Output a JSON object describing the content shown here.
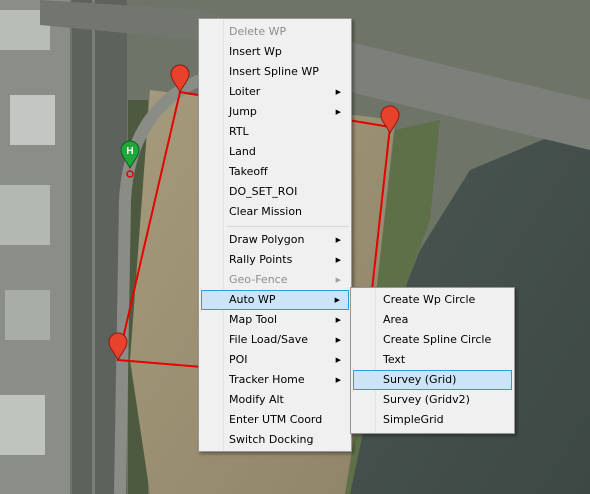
{
  "colors": {
    "mission_line": "#e60000",
    "waypoint_marker": "#e8412c",
    "home_marker": "#1ea83a",
    "menu_bg": "#f0f0f0",
    "menu_highlight": "#cce4f7",
    "menu_highlight_border": "#26a0da"
  },
  "map": {
    "home_marker_label": "H"
  },
  "context_menu": {
    "items": [
      {
        "label": "Delete WP",
        "disabled": true,
        "submenu": false
      },
      {
        "label": "Insert Wp",
        "disabled": false,
        "submenu": false
      },
      {
        "label": "Insert Spline WP",
        "disabled": false,
        "submenu": false
      },
      {
        "label": "Loiter",
        "disabled": false,
        "submenu": true
      },
      {
        "label": "Jump",
        "disabled": false,
        "submenu": true
      },
      {
        "label": "RTL",
        "disabled": false,
        "submenu": false
      },
      {
        "label": "Land",
        "disabled": false,
        "submenu": false
      },
      {
        "label": "Takeoff",
        "disabled": false,
        "submenu": false
      },
      {
        "label": "DO_SET_ROI",
        "disabled": false,
        "submenu": false
      },
      {
        "label": "Clear Mission",
        "disabled": false,
        "submenu": false
      },
      {
        "label": "Draw Polygon",
        "disabled": false,
        "submenu": true
      },
      {
        "label": "Rally Points",
        "disabled": false,
        "submenu": true
      },
      {
        "label": "Geo-Fence",
        "disabled": true,
        "submenu": true
      },
      {
        "label": "Auto WP",
        "disabled": false,
        "submenu": true,
        "highlighted": true
      },
      {
        "label": "Map Tool",
        "disabled": false,
        "submenu": true
      },
      {
        "label": "File Load/Save",
        "disabled": false,
        "submenu": true
      },
      {
        "label": "POI",
        "disabled": false,
        "submenu": true
      },
      {
        "label": "Tracker Home",
        "disabled": false,
        "submenu": true
      },
      {
        "label": "Modify Alt",
        "disabled": false,
        "submenu": false
      },
      {
        "label": "Enter UTM Coord",
        "disabled": false,
        "submenu": false
      },
      {
        "label": "Switch Docking",
        "disabled": false,
        "submenu": false
      }
    ],
    "submenu_arrow": "▶"
  },
  "auto_wp_submenu": {
    "items": [
      {
        "label": "Create Wp Circle"
      },
      {
        "label": "Area"
      },
      {
        "label": "Create Spline Circle"
      },
      {
        "label": "Text"
      },
      {
        "label": "Survey (Grid)",
        "highlighted": true
      },
      {
        "label": "Survey (Gridv2)"
      },
      {
        "label": "SimpleGrid"
      }
    ]
  }
}
